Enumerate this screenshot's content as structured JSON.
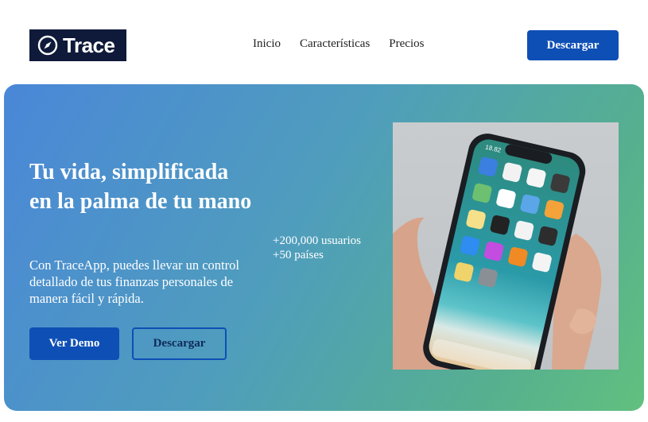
{
  "brand": {
    "name": "Trace"
  },
  "nav": {
    "items": [
      "Inicio",
      "Características",
      "Precios"
    ]
  },
  "header": {
    "download_label": "Descargar"
  },
  "hero": {
    "title": "Tu vida, simplificada en la palma de tu mano",
    "description": "Con TraceApp, puedes llevar un control detallado de tus finanzas personales de manera fácil y rápida.",
    "demo_label": "Ver Demo",
    "download_label": "Descargar",
    "stats": [
      "+200,000 usuarios",
      "+50 países"
    ],
    "phone_time": "18.82"
  },
  "colors": {
    "brand_dark": "#0f1a3a",
    "primary": "#0e4fb5",
    "gradient_start": "#4a87d8",
    "gradient_end": "#62c07f"
  }
}
